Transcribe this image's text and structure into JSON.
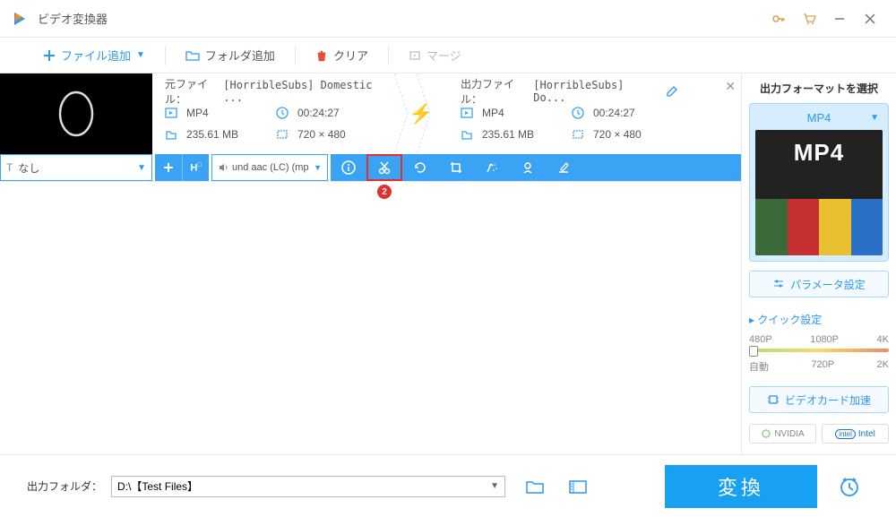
{
  "app": {
    "title": "ビデオ変換器"
  },
  "toolbar": {
    "add_file": "ファイル追加",
    "add_folder": "フォルダ追加",
    "clear": "クリア",
    "merge": "マージ"
  },
  "file": {
    "source_label": "元ファイル：",
    "source_name": "[HorribleSubs] Domestic ...",
    "source_format": "MP4",
    "source_duration": "00:24:27",
    "source_size": "235.61 MB",
    "source_res": "720 × 480",
    "output_label": "出力ファイル：",
    "output_name": "[HorribleSubs] Do...",
    "output_format": "MP4",
    "output_duration": "00:24:27",
    "output_size": "235.61 MB",
    "output_res": "720 × 480",
    "subtitle": "なし",
    "audio": "und aac (LC) (mp"
  },
  "callout": "2",
  "sidebar": {
    "title": "出力フォーマットを選択",
    "format": "MP4",
    "format_badge": "MP4",
    "param_btn": "パラメータ設定",
    "quick_title": "クイック設定",
    "q": {
      "p480": "480P",
      "p1080": "1080P",
      "p4k": "4K",
      "auto": "自動",
      "p720": "720P",
      "p2k": "2K"
    },
    "gpu_btn": "ビデオカード加速",
    "nvidia": "NVIDIA",
    "intel": "Intel"
  },
  "footer": {
    "label": "出力フォルダ：",
    "path": "D:\\【Test Files】",
    "convert": "変換"
  }
}
